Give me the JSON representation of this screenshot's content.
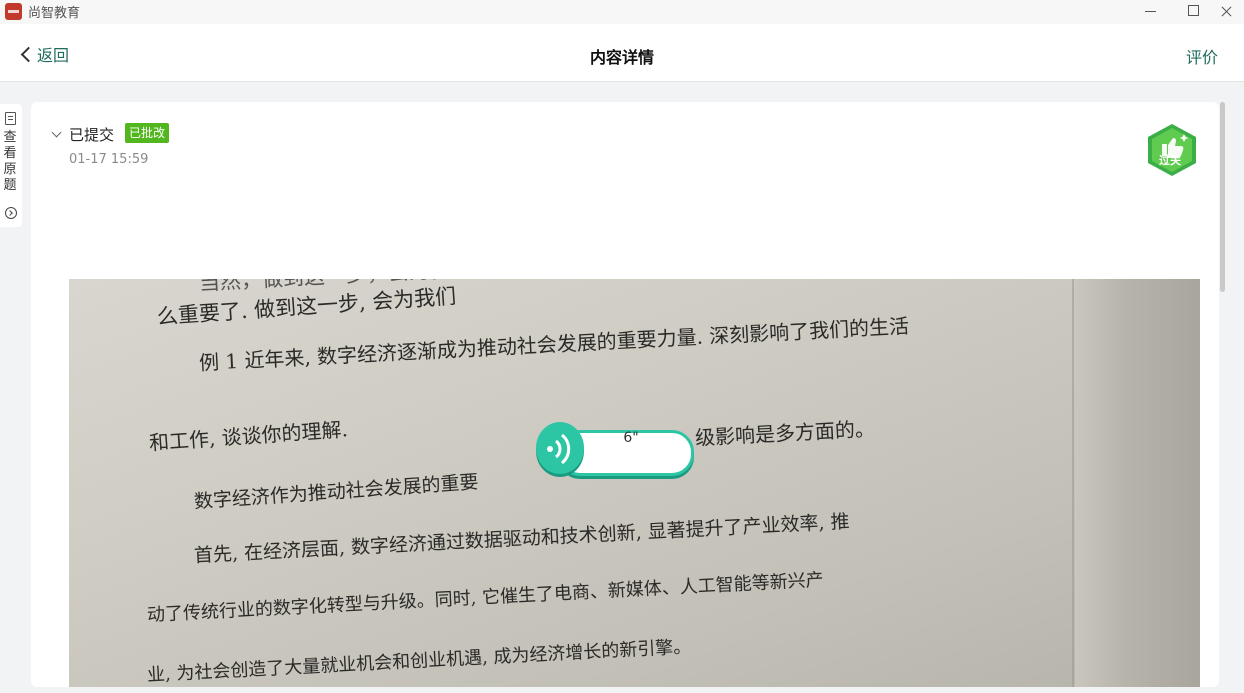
{
  "window": {
    "app_name": "尚智教育"
  },
  "header": {
    "back_label": "返回",
    "title": "内容详情",
    "rate_label": "评价"
  },
  "side_tab": {
    "label": "查看原题"
  },
  "submission": {
    "status": "已提交",
    "badge": "已批改",
    "time": "01-17 15:59",
    "pass_label": "过关"
  },
  "audio": {
    "duration": "6\""
  },
  "photo_text": {
    "lines": [
      "当然，做到这一步，会为我们",
      "么重要了。做到这一步，会为我们",
      "么重要了. 做到这一步, 会为我们",
      "例 1 近年来, 数字经济逐渐成为推动社会发展的重要力量. 深刻影响了我们的生活",
      "和工作, 谈谈你的理解.",
      "级影响是多方面的。",
      "数字经济作为推动社会发展的重要",
      "首先, 在经济层面, 数字经济通过数据驱动和技术创新, 显著提升了产业效率, 推",
      "动了传统行业的数字化转型与升级。同时, 它催生了电商、新媒体、人工智能等新兴产",
      "业, 为社会创造了大量就业机会和创业机遇, 成为经济增长的新引擎。"
    ]
  },
  "colors": {
    "accent": "#2cc6a4",
    "badge_green": "#52b71f",
    "link_green": "#1f6b5e"
  }
}
